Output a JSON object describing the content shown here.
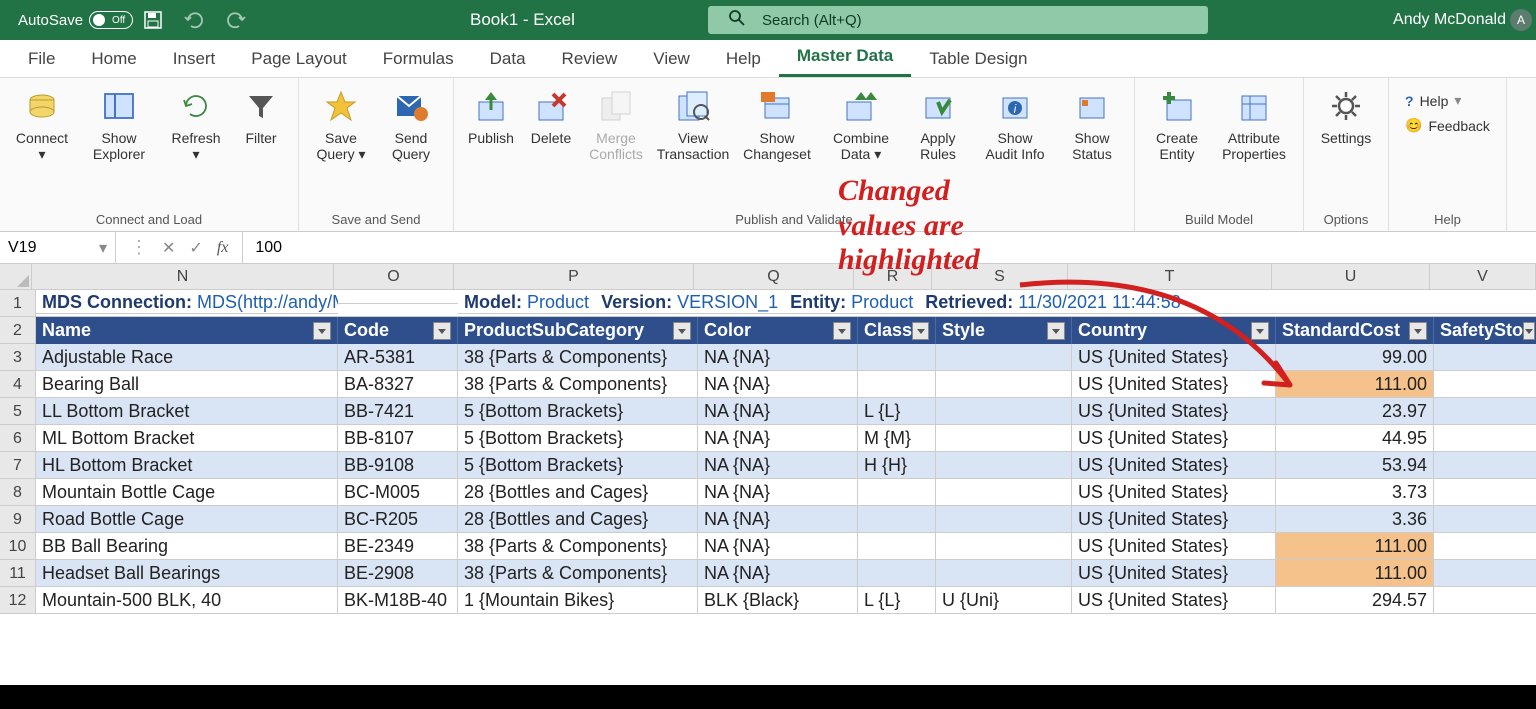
{
  "titlebar": {
    "autosave": "AutoSave",
    "autosave_state": "Off",
    "doc_title": "Book1  -  Excel",
    "search_placeholder": "Search (Alt+Q)",
    "user": "Andy McDonald",
    "avatar_letter": "A"
  },
  "tabs": [
    "File",
    "Home",
    "Insert",
    "Page Layout",
    "Formulas",
    "Data",
    "Review",
    "View",
    "Help",
    "Master Data",
    "Table Design"
  ],
  "active_tab": "Master Data",
  "ribbon": {
    "groups": [
      {
        "label": "Connect and Load",
        "buttons": [
          "Connect",
          "Show Explorer",
          "Refresh",
          "Filter"
        ]
      },
      {
        "label": "Save and Send",
        "buttons": [
          "Save Query",
          "Send Query"
        ]
      },
      {
        "label": "Publish and Validate",
        "buttons": [
          "Publish",
          "Delete",
          "Merge Conflicts",
          "View Transaction",
          "Show Changeset",
          "Combine Data",
          "Apply Rules",
          "Show Audit Info",
          "Show Status"
        ]
      },
      {
        "label": "Build Model",
        "buttons": [
          "Create Entity",
          "Attribute Properties"
        ]
      },
      {
        "label": "Options",
        "buttons": [
          "Settings"
        ]
      },
      {
        "label": "Help",
        "buttons": []
      }
    ],
    "help": "Help",
    "feedback": "Feedback"
  },
  "formula_bar": {
    "name_box": "V19",
    "value": "100"
  },
  "columns": [
    {
      "letter": "N",
      "cls": "col-N"
    },
    {
      "letter": "O",
      "cls": "col-O"
    },
    {
      "letter": "P",
      "cls": "col-P"
    },
    {
      "letter": "Q",
      "cls": "col-Q"
    },
    {
      "letter": "R",
      "cls": "col-R"
    },
    {
      "letter": "S",
      "cls": "col-S"
    },
    {
      "letter": "T",
      "cls": "col-T"
    },
    {
      "letter": "U",
      "cls": "col-U"
    },
    {
      "letter": "V",
      "cls": "col-V"
    }
  ],
  "info": {
    "conn_label": "MDS Connection:",
    "conn_val": "MDS(http://andy/MDS/)",
    "model_label": "Model:",
    "model_val": "Product",
    "version_label": "Version:",
    "version_val": "VERSION_1",
    "entity_label": "Entity:",
    "entity_val": "Product",
    "retrieved_label": "Retrieved:",
    "retrieved_val": "11/30/2021 11:44:58"
  },
  "headers": [
    "Name",
    "Code",
    "ProductSubCategory",
    "Color",
    "Class",
    "Style",
    "Country",
    "StandardCost",
    "SafetySto"
  ],
  "rows": [
    {
      "n": 3,
      "name": "Adjustable Race",
      "code": "AR-5381",
      "psc": "38 {Parts & Components}",
      "color": "NA {NA}",
      "class": "",
      "style": "",
      "country": "US {United States}",
      "cost": "99.00",
      "hl": false
    },
    {
      "n": 4,
      "name": "Bearing Ball",
      "code": "BA-8327",
      "psc": "38 {Parts & Components}",
      "color": "NA {NA}",
      "class": "",
      "style": "",
      "country": "US {United States}",
      "cost": "111.00",
      "hl": true
    },
    {
      "n": 5,
      "name": "LL Bottom Bracket",
      "code": "BB-7421",
      "psc": "5 {Bottom Brackets}",
      "color": "NA {NA}",
      "class": "L {L}",
      "style": "",
      "country": "US {United States}",
      "cost": "23.97",
      "hl": false
    },
    {
      "n": 6,
      "name": "ML Bottom Bracket",
      "code": "BB-8107",
      "psc": "5 {Bottom Brackets}",
      "color": "NA {NA}",
      "class": "M {M}",
      "style": "",
      "country": "US {United States}",
      "cost": "44.95",
      "hl": false
    },
    {
      "n": 7,
      "name": "HL Bottom Bracket",
      "code": "BB-9108",
      "psc": "5 {Bottom Brackets}",
      "color": "NA {NA}",
      "class": "H {H}",
      "style": "",
      "country": "US {United States}",
      "cost": "53.94",
      "hl": false
    },
    {
      "n": 8,
      "name": "Mountain Bottle Cage",
      "code": "BC-M005",
      "psc": "28 {Bottles and Cages}",
      "color": "NA {NA}",
      "class": "",
      "style": "",
      "country": "US {United States}",
      "cost": "3.73",
      "hl": false
    },
    {
      "n": 9,
      "name": "Road Bottle Cage",
      "code": "BC-R205",
      "psc": "28 {Bottles and Cages}",
      "color": "NA {NA}",
      "class": "",
      "style": "",
      "country": "US {United States}",
      "cost": "3.36",
      "hl": false
    },
    {
      "n": 10,
      "name": "BB Ball Bearing",
      "code": "BE-2349",
      "psc": "38 {Parts & Components}",
      "color": "NA {NA}",
      "class": "",
      "style": "",
      "country": "US {United States}",
      "cost": "111.00",
      "hl": true
    },
    {
      "n": 11,
      "name": "Headset Ball Bearings",
      "code": "BE-2908",
      "psc": "38 {Parts & Components}",
      "color": "NA {NA}",
      "class": "",
      "style": "",
      "country": "US {United States}",
      "cost": "111.00",
      "hl": true
    },
    {
      "n": 12,
      "name": "Mountain-500 BLK, 40",
      "code": "BK-M18B-40",
      "psc": "1 {Mountain Bikes}",
      "color": "BLK {Black}",
      "class": "L {L}",
      "style": "U {Uni}",
      "country": "US {United States}",
      "cost": "294.57",
      "hl": false
    }
  ],
  "annotation": "Changed values are highlighted"
}
